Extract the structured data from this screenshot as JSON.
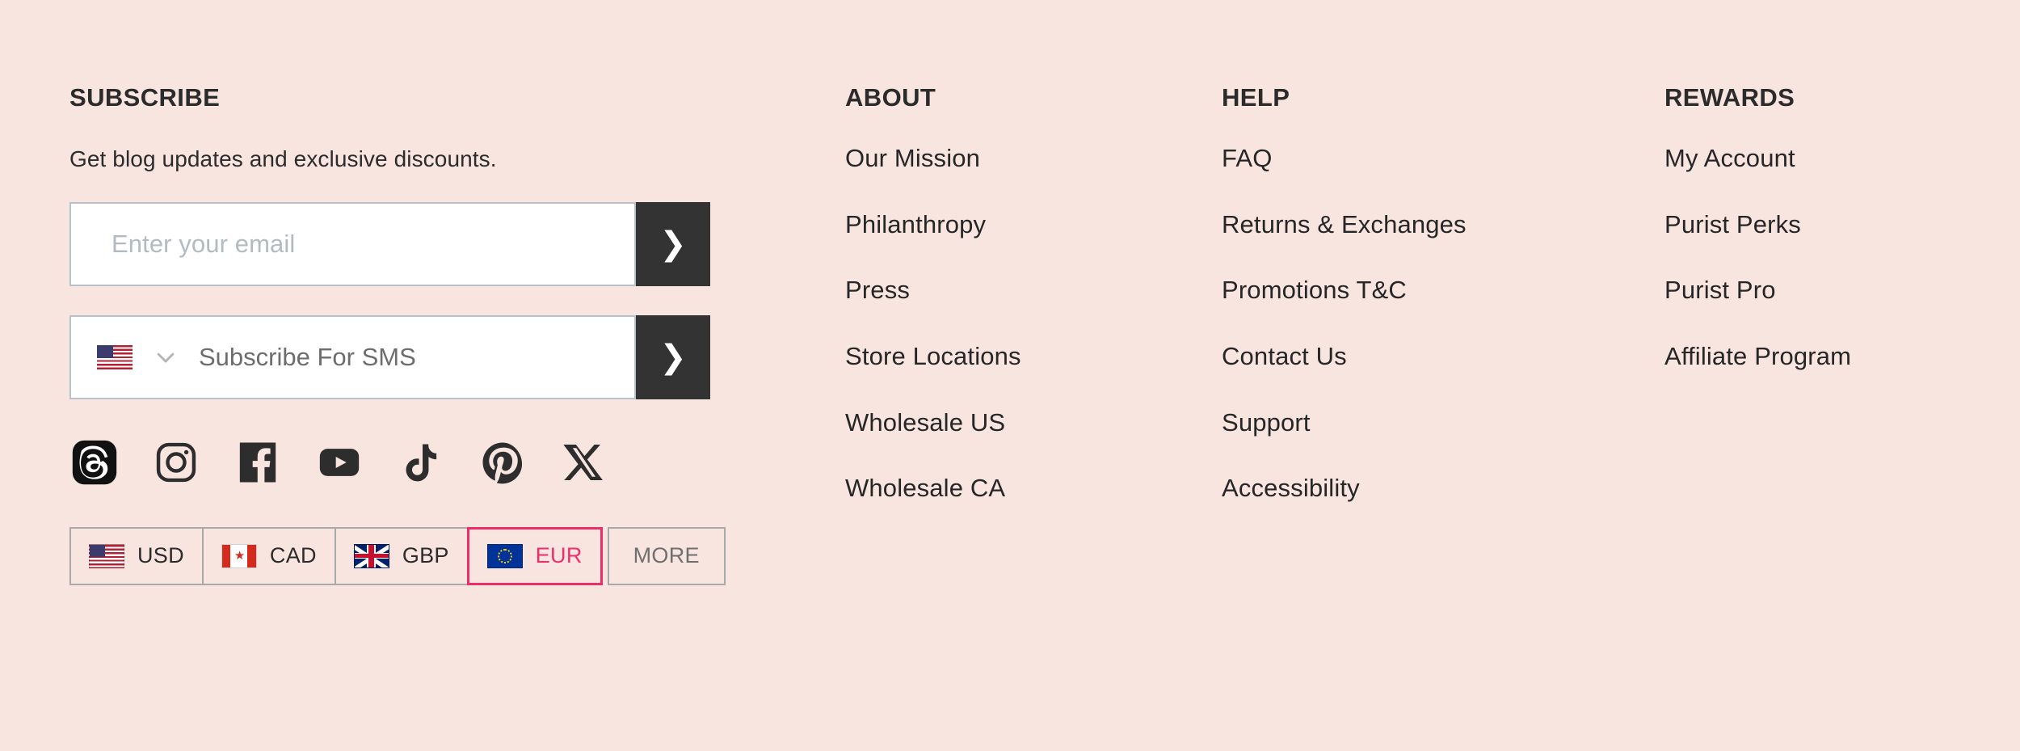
{
  "theme": {
    "background": "#f8e5df",
    "text": "#262626",
    "heading": "#2b2b2b",
    "button_dark": "#333333",
    "accent_pink": "#ef2d6b",
    "field_border": "#b9c2c9",
    "placeholder": "#b3bac1",
    "muted": "#6f6f6f"
  },
  "subscribe": {
    "heading": "SUBSCRIBE",
    "tagline": "Get blog updates and exclusive discounts.",
    "email_field": {
      "value": "",
      "placeholder": "Enter your email",
      "submit_label": "❯",
      "submit_icon": "chevron-right-icon"
    },
    "sms_field": {
      "value": "",
      "placeholder": "Subscribe For SMS",
      "country_flag": "flag-us-icon",
      "dropdown_icon": "chevron-down-icon",
      "submit_label": "❯",
      "submit_icon": "chevron-right-icon"
    },
    "social": [
      {
        "name": "threads-icon",
        "label": "Threads"
      },
      {
        "name": "instagram-icon",
        "label": "Instagram"
      },
      {
        "name": "facebook-icon",
        "label": "Facebook"
      },
      {
        "name": "youtube-icon",
        "label": "YouTube"
      },
      {
        "name": "tiktok-icon",
        "label": "TikTok"
      },
      {
        "name": "pinterest-icon",
        "label": "Pinterest"
      },
      {
        "name": "x-twitter-icon",
        "label": "X"
      }
    ],
    "currencies": [
      {
        "code": "USD",
        "flag": "flag-us-icon",
        "selected": false
      },
      {
        "code": "CAD",
        "flag": "flag-ca-icon",
        "selected": false
      },
      {
        "code": "GBP",
        "flag": "flag-gb-icon",
        "selected": false
      },
      {
        "code": "EUR",
        "flag": "flag-eu-icon",
        "selected": true
      },
      {
        "code": "MORE",
        "flag": "",
        "selected": false
      }
    ]
  },
  "columns": {
    "about": {
      "heading": "ABOUT",
      "links": [
        "Our Mission",
        "Philanthropy",
        "Press",
        "Store Locations",
        "Wholesale US",
        "Wholesale CA"
      ]
    },
    "help": {
      "heading": "HELP",
      "links": [
        "FAQ",
        "Returns & Exchanges",
        "Promotions T&C",
        "Contact Us",
        "Support",
        "Accessibility"
      ]
    },
    "rewards": {
      "heading": "REWARDS",
      "links": [
        "My Account",
        "Purist Perks",
        "Purist Pro",
        "Affiliate Program"
      ]
    }
  }
}
